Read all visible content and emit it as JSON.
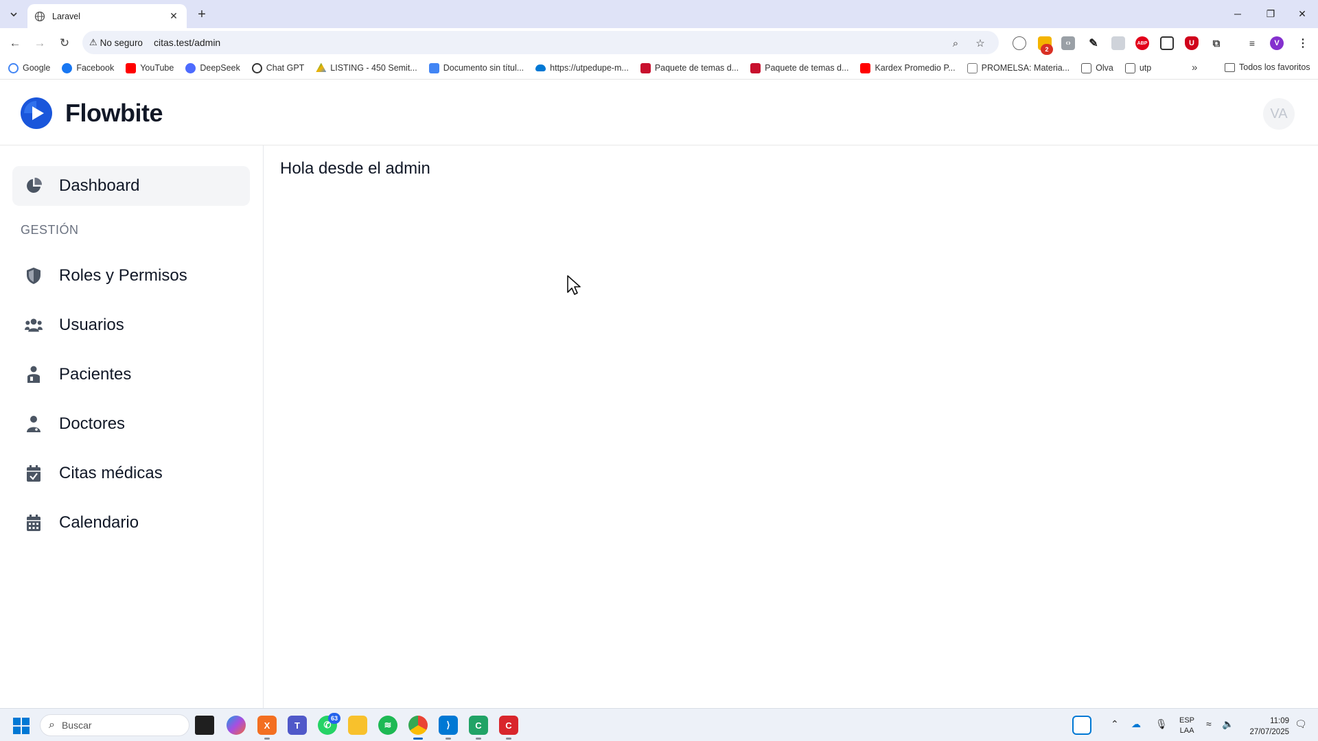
{
  "browser": {
    "tab_title": "Laravel",
    "omnibox": {
      "security_label": "No seguro",
      "url": "citas.test/admin"
    },
    "extension_badge": "2",
    "profile_initial": "V",
    "bookmarks": [
      {
        "label": "Google",
        "color": "#4285f4"
      },
      {
        "label": "Facebook",
        "color": "#1877f2"
      },
      {
        "label": "YouTube",
        "color": "#ff0000"
      },
      {
        "label": "DeepSeek",
        "color": "#4d6bfe"
      },
      {
        "label": "Chat GPT",
        "color": "#333333"
      },
      {
        "label": "LISTING - 450 Semit...",
        "color": "#0f9d58"
      },
      {
        "label": "Documento sin títul...",
        "color": "#4285f4"
      },
      {
        "label": "https://utpedupe-m...",
        "color": "#0078d4"
      },
      {
        "label": "Paquete de temas d...",
        "color": "#c8102e"
      },
      {
        "label": "Paquete de temas d...",
        "color": "#c8102e"
      },
      {
        "label": "Kardex Promedio P...",
        "color": "#ff0000"
      },
      {
        "label": "PROMELSA: Materia...",
        "color": "#777777"
      },
      {
        "label": "Olva",
        "color": "#555555"
      },
      {
        "label": "utp",
        "color": "#555555"
      }
    ],
    "all_bookmarks": "Todos los favoritos"
  },
  "app": {
    "brand": "Flowbite",
    "brand_color": "#1a56db",
    "avatar_initials": "VA",
    "sidebar": {
      "dashboard": "Dashboard",
      "section_title": "GESTIÓN",
      "items": [
        {
          "label": "Roles y Permisos",
          "icon": "shield-icon"
        },
        {
          "label": "Usuarios",
          "icon": "users-icon"
        },
        {
          "label": "Pacientes",
          "icon": "patient-icon"
        },
        {
          "label": "Doctores",
          "icon": "doctor-icon"
        },
        {
          "label": "Citas médicas",
          "icon": "calendar-check-icon"
        },
        {
          "label": "Calendario",
          "icon": "calendar-icon"
        }
      ]
    },
    "main": {
      "greeting": "Hola desde el admin"
    }
  },
  "taskbar": {
    "search_placeholder": "Buscar",
    "whatsapp_badge": "63",
    "language": "ESP",
    "layout": "LAA",
    "time": "11:09",
    "date": "27/07/2025"
  }
}
